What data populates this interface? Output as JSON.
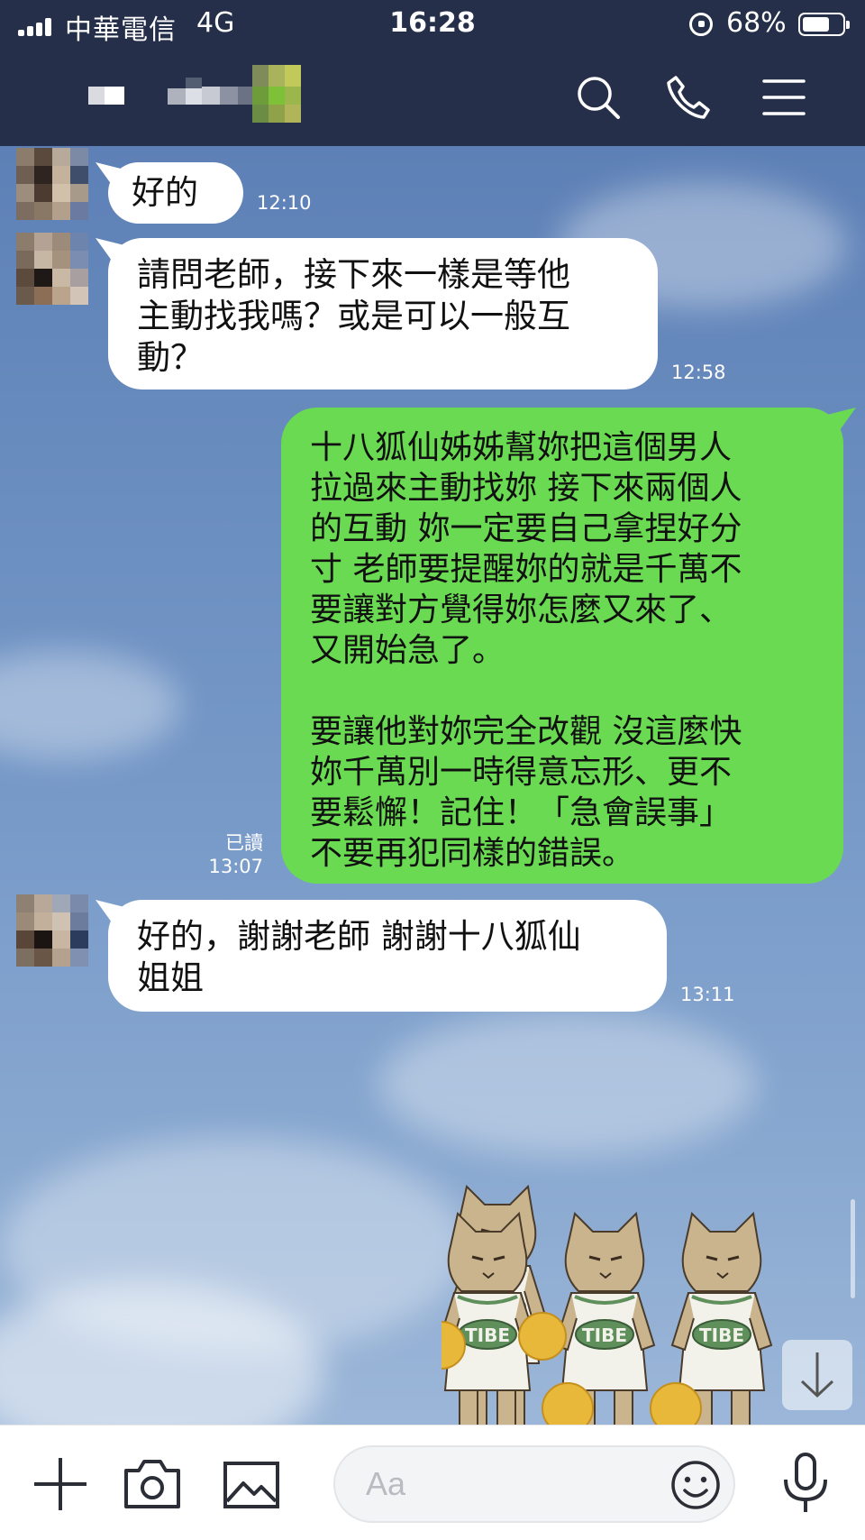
{
  "status_bar": {
    "carrier": "中華電信",
    "network": "4G",
    "time": "16:28",
    "battery": "68%",
    "battery_level": 0.68,
    "signal_icon": "signal-bars-icon",
    "rotation_lock_icon": "rotation-lock-icon",
    "battery_icon": "battery-icon"
  },
  "header": {
    "icons": {
      "search": "search-icon",
      "call": "phone-icon",
      "menu": "hamburger-menu-icon"
    }
  },
  "messages": [
    {
      "side": "in",
      "text": "好的",
      "time": "12:10"
    },
    {
      "side": "in",
      "text": "請問老師，接下來一樣是等他\n主動找我嗎？或是可以一般互\n動？",
      "time": "12:58"
    },
    {
      "side": "out",
      "text": "十八狐仙姊姊幫妳把這個男人\n拉過來主動找妳 接下來兩個人\n的互動 妳一定要自己拿捏好分\n寸 老師要提醒妳的就是千萬不\n要讓對方覺得妳怎麼又來了、\n又開始急了。\n\n要讓他對妳完全改觀 沒這麼快\n妳千萬別一時得意忘形、更不\n要鬆懈！記住！「急會誤事」\n不要再犯同樣的錯誤。",
      "read": "已讀",
      "time": "13:07"
    },
    {
      "side": "in",
      "text": "好的，謝謝老師 謝謝十八狐仙\n姐姐",
      "time": "13:11"
    }
  ],
  "sticker": {
    "label": "TIBE",
    "description": "three-cheerleader-cats-sticker"
  },
  "input_bar": {
    "placeholder": "Aa",
    "icons": {
      "add": "plus-icon",
      "camera": "camera-icon",
      "image": "image-icon",
      "emoji": "smiley-icon",
      "mic": "microphone-icon"
    }
  },
  "colors": {
    "header_bg": "#252f49",
    "outgoing_bubble": "#6ada52",
    "incoming_bubble": "#ffffff",
    "chat_bg": "#7396c6"
  }
}
